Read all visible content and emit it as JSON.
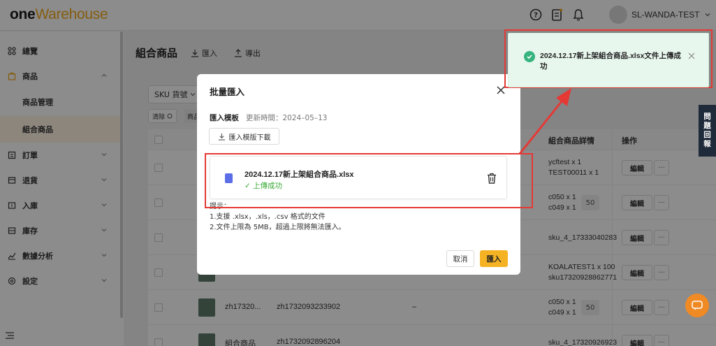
{
  "header": {
    "logo_one": "one",
    "logo_warehouse": "Warehouse",
    "user_name": "SL-WANDA-TEST"
  },
  "sidebar": {
    "items": [
      {
        "label": "總覽",
        "icon": "grid-icon"
      },
      {
        "label": "商品",
        "icon": "box-icon"
      },
      {
        "label": "商品管理"
      },
      {
        "label": "組合商品"
      },
      {
        "label": "訂單",
        "icon": "order-icon"
      },
      {
        "label": "退貨",
        "icon": "return-icon"
      },
      {
        "label": "入庫",
        "icon": "inbound-icon"
      },
      {
        "label": "庫存",
        "icon": "inventory-icon"
      },
      {
        "label": "數據分析",
        "icon": "chart-icon"
      },
      {
        "label": "設定",
        "icon": "settings-icon"
      }
    ]
  },
  "main": {
    "title": "組合商品",
    "import_label": "匯入",
    "export_label": "導出",
    "filter_select": "SKU 貨號",
    "clear_label": "清除",
    "tag_fragment": "商品",
    "columns": {
      "detail": "組合商品詳情",
      "action": "操作"
    },
    "rows": [
      {
        "detail": [
          "ycftest x 1",
          "TEST00011 x 1"
        ],
        "badge": ""
      },
      {
        "detail": [
          "c050 x 1",
          "c049 x 1"
        ],
        "badge": "50"
      },
      {
        "detail": [
          "sku_4_17333040283"
        ],
        "badge": ""
      },
      {
        "detail": [
          "KOALATEST1 x 100",
          "sku17320928862771"
        ],
        "badge": ""
      },
      {
        "detail": [
          "c050 x 1",
          "c049 x 1"
        ],
        "badge": "50",
        "name": "zh17320...",
        "sku": "zh1732093233902",
        "dash": "–"
      },
      {
        "detail": [
          "sku_4_17320926923"
        ],
        "badge": "",
        "name": "組合商品",
        "sku": "zh1732092896204"
      }
    ],
    "edit_label": "編輯",
    "more_label": "···"
  },
  "modal": {
    "title": "批量匯入",
    "template_label": "匯入模板",
    "template_time": "更新時間：2024–05–13",
    "download_label": "匯入模版下載",
    "file_name": "2024.12.17新上架組合商品.xlsx",
    "file_status": "✓ 上傳成功",
    "tips_title": "提示：",
    "tip1": "1.支援 .xlsx，.xls，.csv 格式的文件",
    "tip2": "2.文件上限為 5MB，超過上限將無法匯入。",
    "cancel_label": "取消",
    "ok_label": "匯入"
  },
  "toast": {
    "message": "2024.12.17新上架組合商品.xlsx文件上傳成功"
  },
  "feedback_tab": [
    "問",
    "題",
    "回",
    "報"
  ],
  "colors": {
    "accent": "#f5b324",
    "success": "#36b37e",
    "annotation": "#e53935"
  }
}
